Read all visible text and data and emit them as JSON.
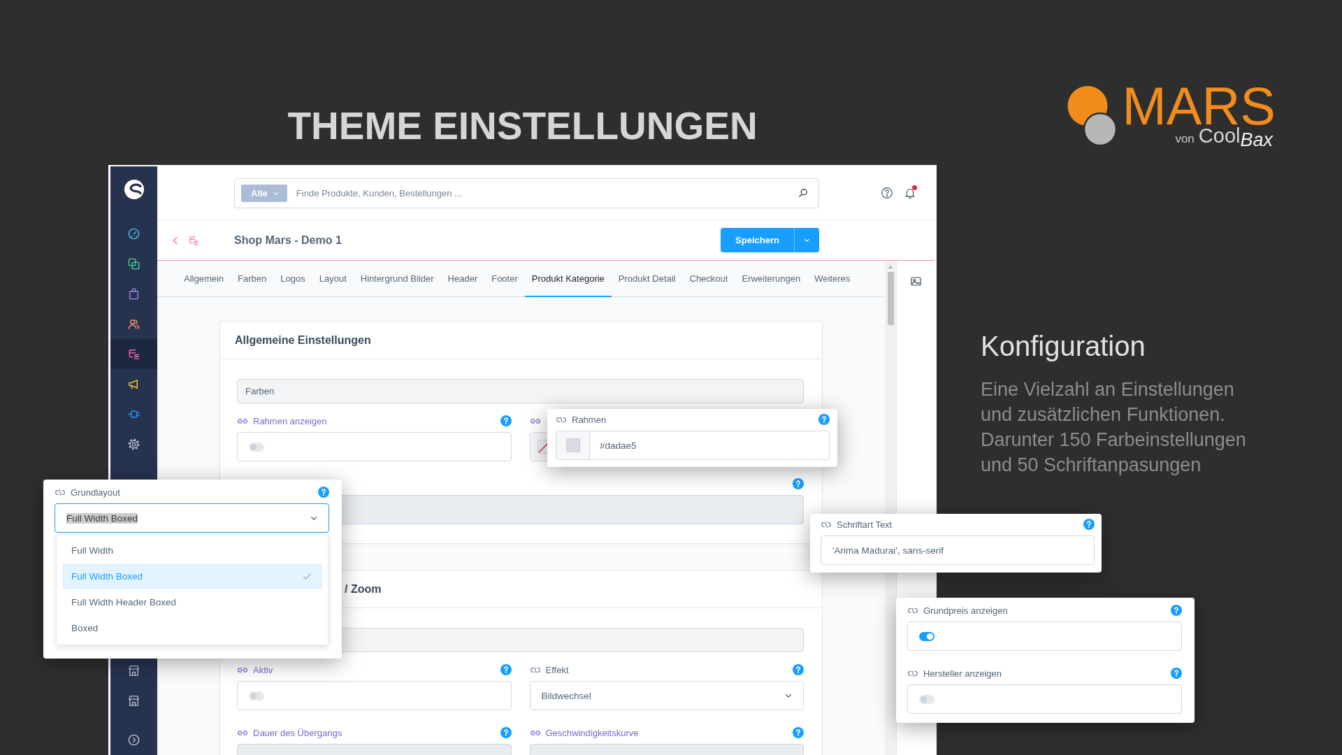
{
  "title": "THEME EINSTELLUNGEN",
  "logo": {
    "wordmark": "MARS",
    "byline_prefix": "von",
    "byline": "Cool",
    "byline_suffix": "Bax"
  },
  "feature": {
    "heading": "Konfiguration",
    "text": "Eine Vielzahl an Einstellungen und zusätzlichen Funktionen. Darunter 150 Farbeinstellungen und 50 Schriftanpasungen"
  },
  "app": {
    "sidebar": {
      "items": [
        {
          "selected": false
        },
        {
          "selected": false
        },
        {
          "selected": false
        },
        {
          "selected": false
        },
        {
          "selected": true
        },
        {
          "selected": false
        },
        {
          "selected": false
        },
        {
          "selected": false
        }
      ]
    },
    "search": {
      "filter": "Alle",
      "placeholder": "Finde Produkte, Kunden, Bestellungen ..."
    },
    "notifications": {
      "unread": true
    },
    "page_title": "Shop Mars - Demo 1",
    "save_button": "Speichern",
    "tabs": [
      {
        "label": "Allgemein",
        "selected": false
      },
      {
        "label": "Farben",
        "selected": false
      },
      {
        "label": "Logos",
        "selected": false
      },
      {
        "label": "Layout",
        "selected": false
      },
      {
        "label": "Hintergrund Bilder",
        "selected": false
      },
      {
        "label": "Header",
        "selected": false
      },
      {
        "label": "Footer",
        "selected": false
      },
      {
        "label": "Produkt Kategorie",
        "selected": true
      },
      {
        "label": "Produkt Detail",
        "selected": false
      },
      {
        "label": "Checkout",
        "selected": false
      },
      {
        "label": "Erweiterungen",
        "selected": false
      },
      {
        "label": "Weiteres",
        "selected": false
      }
    ],
    "cards": [
      {
        "title": "Allgemeine Einstellungen",
        "items": [
          {
            "kind": "section",
            "label": "Farben"
          },
          {
            "kind": "toggle",
            "label": "Rahmen anzeigen",
            "linked": true,
            "help": true,
            "on": false
          },
          {
            "kind": "color",
            "linked": true
          },
          {
            "kind": "text",
            "help": true,
            "wide": true,
            "disabled": true
          }
        ]
      },
      {
        "title": "/ Zoom",
        "items": [
          {
            "kind": "section"
          },
          {
            "kind": "toggle",
            "label": "Aktiv",
            "linked": true,
            "help": true,
            "on": false
          },
          {
            "kind": "select",
            "label": "Effekt",
            "linked": false,
            "help": true,
            "value": "Bildwechsel",
            "expanded": false
          },
          {
            "kind": "text",
            "label": "Dauer des Übergangs",
            "linked": true,
            "help": true,
            "disabled": true
          },
          {
            "kind": "text",
            "label": "Geschwindigkeitskurve",
            "linked": true,
            "help": true,
            "disabled": true
          }
        ]
      }
    ]
  },
  "popups": [
    {
      "fields": [
        {
          "kind": "select",
          "label": "Grundlayout",
          "linked": false,
          "help": true,
          "value": "Full Width Boxed",
          "value_highlighted": true,
          "expanded": true,
          "options": [
            {
              "label": "Full Width",
              "selected": false
            },
            {
              "label": "Full Width Boxed",
              "selected": true
            },
            {
              "label": "Full Width Header Boxed",
              "selected": false
            },
            {
              "label": "Boxed",
              "selected": false
            }
          ]
        }
      ]
    },
    {
      "fields": [
        {
          "kind": "color",
          "label": "Rahmen",
          "linked": false,
          "help": true,
          "value": "#dadae5"
        }
      ]
    },
    {
      "fields": [
        {
          "kind": "text",
          "label": "Schriftart Text",
          "linked": false,
          "help": true,
          "value": "'Arima Madurai', sans-serif"
        }
      ]
    },
    {
      "fields": [
        {
          "kind": "toggle",
          "label": "Grundpreis anzeigen",
          "linked": false,
          "help": true,
          "on": true
        },
        {
          "kind": "toggle",
          "label": "Hersteller anzeigen",
          "linked": false,
          "help": true,
          "on": false
        }
      ]
    }
  ]
}
